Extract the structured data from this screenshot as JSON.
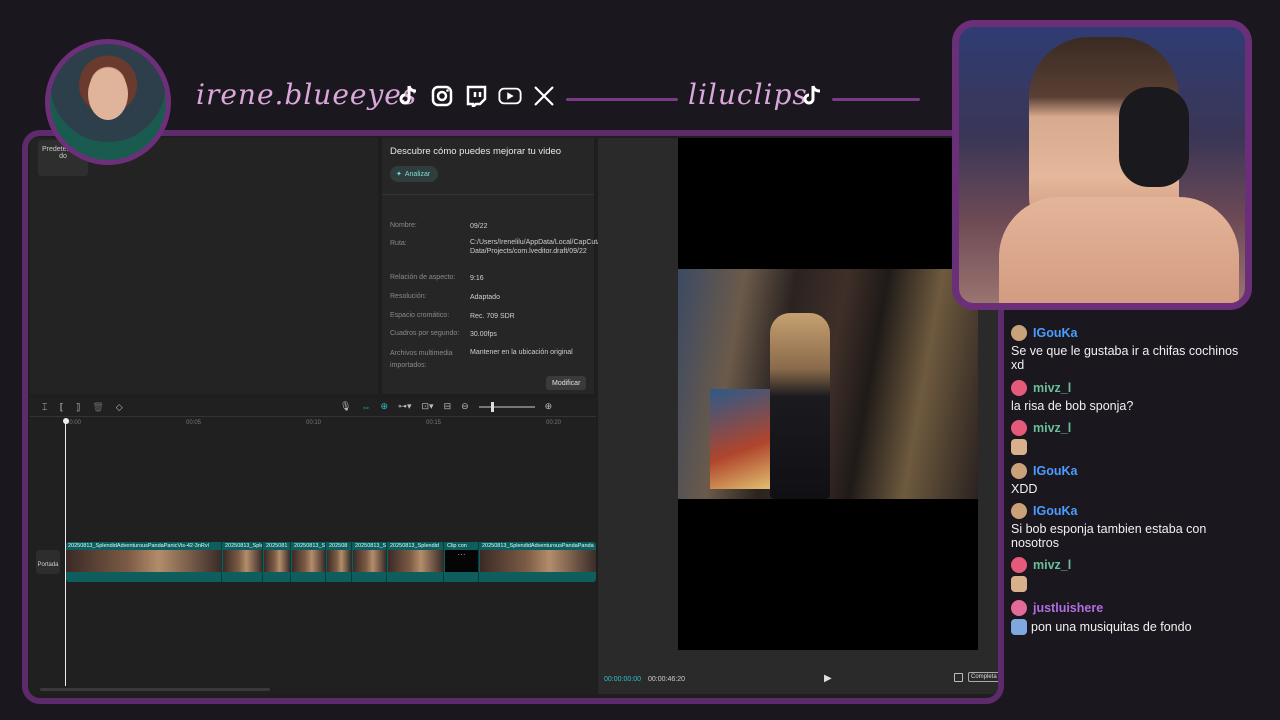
{
  "overlay": {
    "streamer_handle": "irene.blueeyes",
    "clips_handle": "liluclips",
    "social_icons": [
      "tiktok-icon",
      "instagram-icon",
      "twitch-icon",
      "youtube-icon",
      "x-icon"
    ],
    "accent_color": "#6a2f78"
  },
  "editor": {
    "media_panel": {
      "label": "Predetermina do"
    },
    "analysis": {
      "title": "Descubre cómo puedes mejorar tu video",
      "analyze_button": "Analizar"
    },
    "properties": [
      {
        "label": "Nombre:",
        "value": "09/22"
      },
      {
        "label": "Ruta:",
        "value": "C:/Users/Irenelilu/AppData/Local/CapCut/User Data/Projects/com.lveditor.draft/09/22"
      },
      {
        "label": "Relación de aspecto:",
        "value": "9:16"
      },
      {
        "label": "Resolución:",
        "value": "Adaptado"
      },
      {
        "label": "Espacio cromático:",
        "value": "Rec. 709 SDR"
      },
      {
        "label": "Cuadros por segundo:",
        "value": "30.00fps"
      },
      {
        "label": "Archivos multimedia importados:",
        "value": "Mantener en la ubicación original"
      }
    ],
    "modify_button": "Modificar",
    "timeline": {
      "ticks": [
        "00:00",
        "00:05",
        "00:10",
        "00:15",
        "00:20"
      ],
      "cover_label": "Portada",
      "clips": [
        "20250813_SplendidAdventurousPandaPanicVis-42-3nRvl",
        "20250813_Sple",
        "2025081",
        "20250813_S",
        "202508",
        "20250813_S",
        "20250813_Splendid",
        "Clip con",
        "20250813_SplendidAdventurousPandaPanda"
      ]
    },
    "player": {
      "current_time": "00:00:00:00",
      "total_time": "00:00:46:20",
      "ratio_label": "Completa"
    }
  },
  "chat": [
    {
      "user": "IGouKa",
      "user_color": "#4a9eff",
      "badge_color": "#c9a27a",
      "text": "Se ve que le gustaba ir a chifas cochinos xd"
    },
    {
      "user": "mivz_l",
      "user_color": "#6abf9a",
      "badge_color": "#e45a7a",
      "text": "la risa de bob sponja?"
    },
    {
      "user": "mivz_l",
      "user_color": "#6abf9a",
      "badge_color": "#e45a7a",
      "emote": "face-emote"
    },
    {
      "user": "IGouKa",
      "user_color": "#4a9eff",
      "badge_color": "#c9a27a",
      "text": "XDD"
    },
    {
      "user": "IGouKa",
      "user_color": "#4a9eff",
      "badge_color": "#c9a27a",
      "text": "Si bob esponja tambien estaba con nosotros"
    },
    {
      "user": "mivz_l",
      "user_color": "#6abf9a",
      "badge_color": "#e45a7a",
      "emote": "face-emote"
    },
    {
      "user": "justluishere",
      "user_color": "#b06ee0",
      "badge_color": "#e46a9a",
      "text": "pon una musiquitas de fondo",
      "emote": "controller-emote"
    }
  ]
}
